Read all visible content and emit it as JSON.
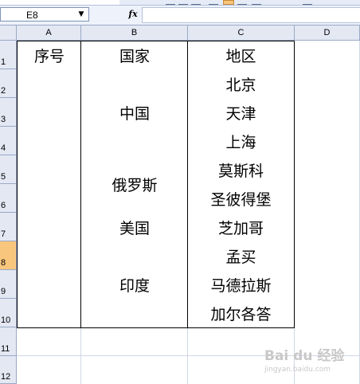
{
  "namebox": {
    "value": "E8"
  },
  "formula": {
    "fx_label": "fx",
    "value": ""
  },
  "columns": [
    "A",
    "B",
    "C",
    "D"
  ],
  "rows": [
    "1",
    "2",
    "3",
    "4",
    "5",
    "6",
    "7",
    "8",
    "9",
    "10",
    "11",
    "12"
  ],
  "selected_row": "8",
  "table": {
    "header": {
      "a": "序号",
      "b": "国家",
      "c": "地区"
    },
    "groups": [
      {
        "country": "中国",
        "regions": [
          "北京",
          "天津",
          "上海"
        ]
      },
      {
        "country": "俄罗斯",
        "regions": [
          "莫斯科",
          "圣彼得堡"
        ]
      },
      {
        "country": "美国",
        "regions": [
          "芝加哥"
        ]
      },
      {
        "country": "印度",
        "regions": [
          "孟买",
          "马德拉斯",
          "加尔各答"
        ]
      }
    ]
  },
  "watermark": {
    "main": "Bai du 经验",
    "sub": "jingyan.baidu.com"
  },
  "colors": {
    "header_bg": "#e3e8f3",
    "selected_row": "#f8c67c",
    "border": "#000000"
  }
}
